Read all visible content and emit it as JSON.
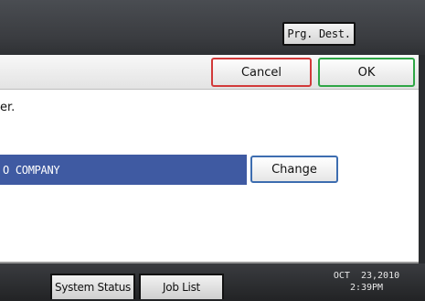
{
  "toolbar": {
    "prg_dest_label": "Prg. Dest."
  },
  "dialog": {
    "cancel_label": "Cancel",
    "ok_label": "OK",
    "message_fragment": "er.",
    "field_value": "O COMPANY",
    "change_label": "Change"
  },
  "statusbar": {
    "system_status_label": "System Status",
    "job_list_label": "Job List",
    "date": "OCT  23,2010",
    "time": "2:39PM"
  },
  "colors": {
    "cancel_border": "#d23a3a",
    "ok_border": "#2fa646",
    "selected_field_bg": "#3f5aa2",
    "change_border": "#3d6db0"
  }
}
